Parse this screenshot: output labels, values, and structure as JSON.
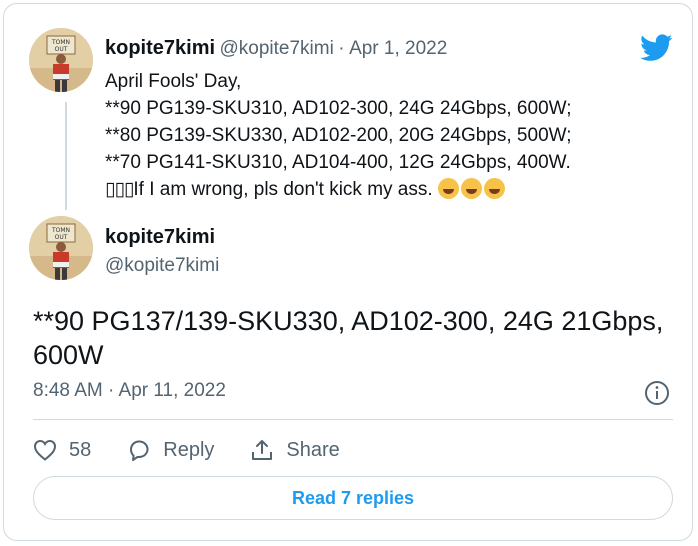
{
  "quoted_tweet": {
    "author_name": "kopite7kimi",
    "author_handle": "@kopite7kimi",
    "separator": "·",
    "date": "Apr 1, 2022",
    "lines": [
      "April Fools' Day,",
      "**90 PG139-SKU310, AD102-300, 24G 24Gbps, 600W;",
      "**80 PG139-SKU330, AD102-200, 20G 24Gbps, 500W;",
      "**70 PG141-SKU310, AD104-400, 12G 24Gbps, 400W."
    ],
    "last_line_prefix": "▯▯▯",
    "last_line_text": "If I am wrong, pls don't kick my ass. ",
    "last_line_emojis": [
      "rolling-on-floor-laughing-emoji",
      "rolling-on-floor-laughing-emoji",
      "rolling-on-floor-laughing-emoji"
    ]
  },
  "main_tweet": {
    "author_name": "kopite7kimi",
    "author_handle": "@kopite7kimi",
    "text": "**90 PG137/139-SKU330, AD102-300, 24G 21Gbps, 600W",
    "time": "8:48 AM · Apr 11, 2022"
  },
  "actions": {
    "like_count": "58",
    "reply_label": "Reply",
    "share_label": "Share"
  },
  "read_replies_label": "Read 7 replies",
  "colors": {
    "accent": "#1d9bf0",
    "text": "#0f1419",
    "muted": "#536471",
    "border": "#cfd9de"
  },
  "icons": [
    "twitter-logo-icon",
    "heart-icon",
    "reply-bubble-icon",
    "share-icon",
    "info-icon"
  ]
}
